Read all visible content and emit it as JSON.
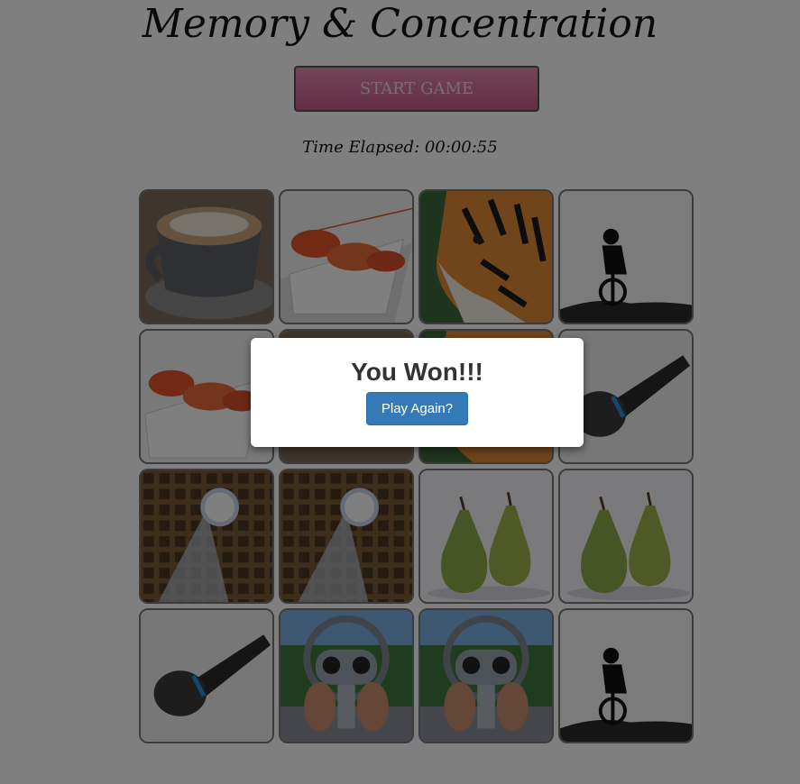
{
  "game": {
    "title": "Memory & Concentration",
    "start_label": "START GAME",
    "timer_text": "Time Elapsed: 00:00:55"
  },
  "board": {
    "cards": [
      {
        "icon": "coffee-cup"
      },
      {
        "icon": "shrimp"
      },
      {
        "icon": "tiger"
      },
      {
        "icon": "cyclist"
      },
      {
        "icon": "shrimp"
      },
      {
        "icon": "coffee-cup"
      },
      {
        "icon": "tiger"
      },
      {
        "icon": "microphone"
      },
      {
        "icon": "pantheon-oculus"
      },
      {
        "icon": "pantheon-oculus"
      },
      {
        "icon": "pears"
      },
      {
        "icon": "pears"
      },
      {
        "icon": "microphone"
      },
      {
        "icon": "binocular-viewer"
      },
      {
        "icon": "binocular-viewer"
      },
      {
        "icon": "cyclist"
      }
    ]
  },
  "modal": {
    "title": "You Won!!!",
    "button_label": "Play Again?"
  },
  "colors": {
    "start_button": "#d96b9c",
    "play_again_button": "#337ab7",
    "overlay": "rgba(0,0,0,0.5)"
  }
}
